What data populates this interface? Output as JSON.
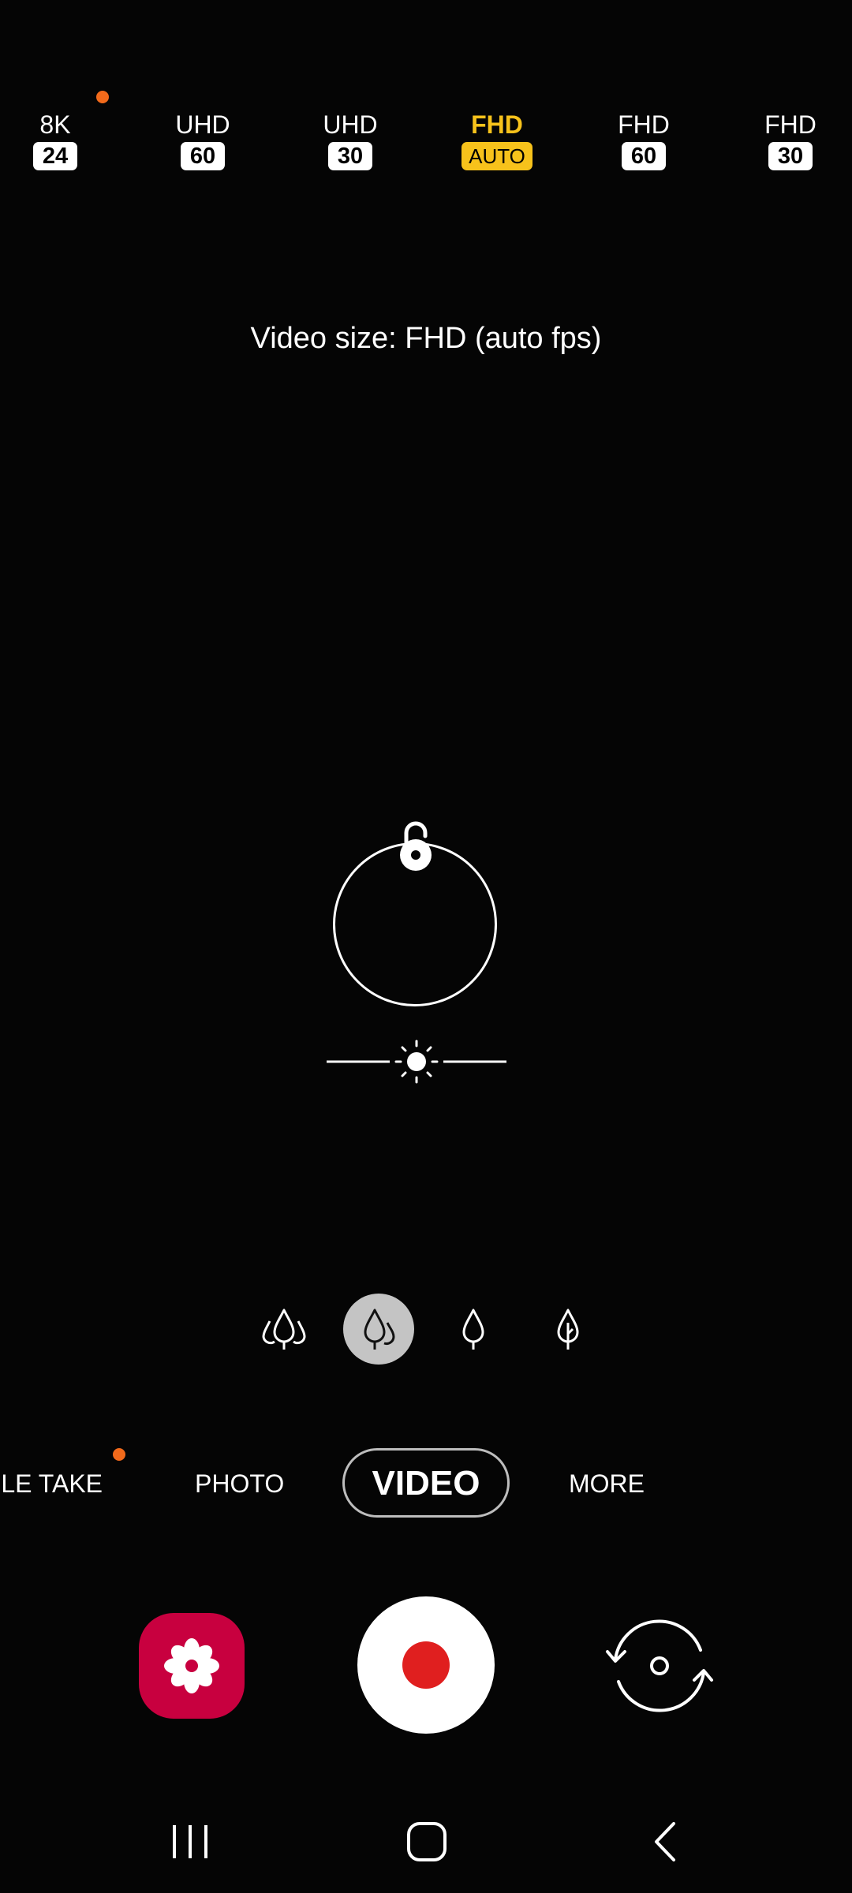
{
  "resolutions": [
    {
      "label": "8K",
      "badge": "24"
    },
    {
      "label": "UHD",
      "badge": "60"
    },
    {
      "label": "UHD",
      "badge": "30"
    },
    {
      "label": "FHD",
      "badge": "AUTO",
      "selected": true
    },
    {
      "label": "FHD",
      "badge": "60"
    },
    {
      "label": "FHD",
      "badge": "30"
    }
  ],
  "toast": "Video size: FHD (auto fps)",
  "modes": {
    "single_take": "GLE TAKE",
    "photo": "PHOTO",
    "video": "VIDEO",
    "more": "MORE"
  },
  "colors": {
    "selected_yellow": "#f7c21b",
    "new_dot": "#f26a1b",
    "gallery_bg": "#c8003f",
    "record_red": "#e01f1f"
  },
  "icons": {
    "lock": "unlocked-padlock-icon",
    "exposure": "sun-icon",
    "gallery": "flower-icon",
    "flip": "camera-switch-icon",
    "nav": [
      "recent-apps-icon",
      "home-icon",
      "back-icon"
    ]
  }
}
